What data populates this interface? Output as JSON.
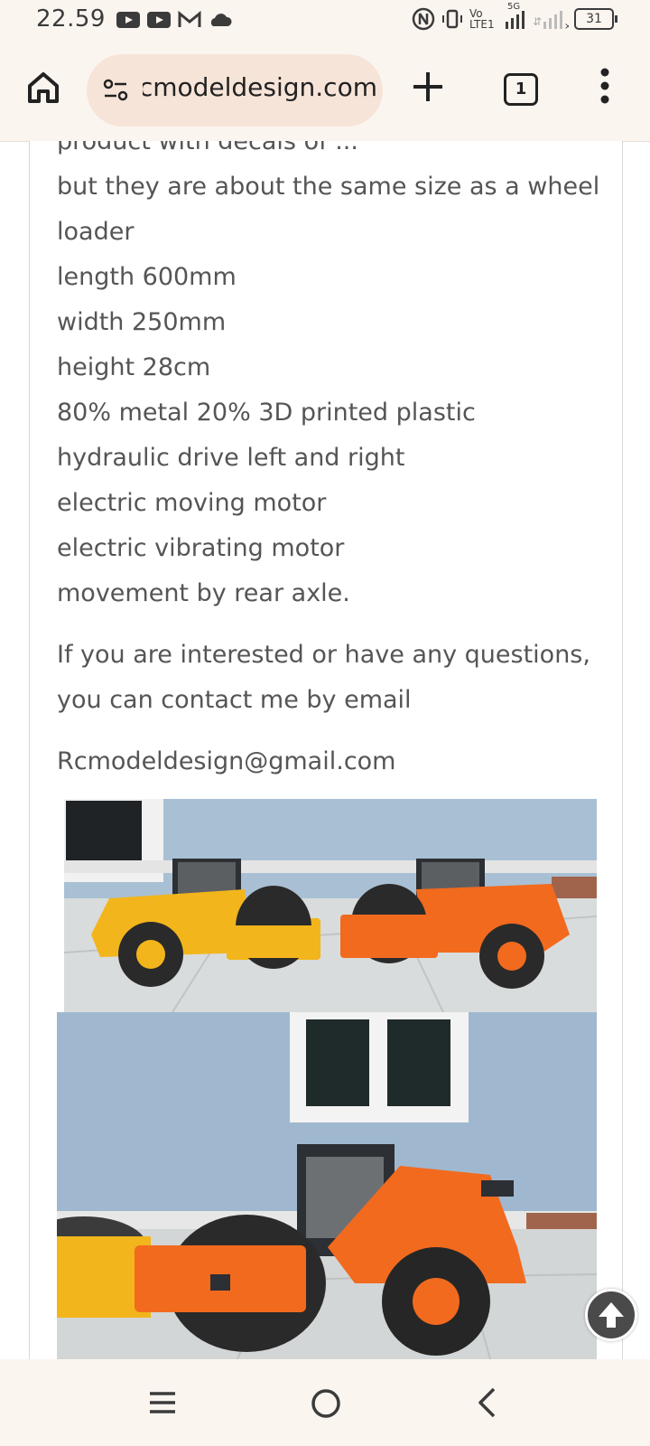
{
  "status_bar": {
    "time": "22.59",
    "network_vo": "Vo",
    "network_lte": "LTE1",
    "network_5g": "5G",
    "battery": "31"
  },
  "toolbar": {
    "url": "rcmodeldesign.com",
    "tab_count": "1"
  },
  "content": {
    "partial_line": "product with decals of ...",
    "lines": [
      "but they are about the same size as a wheel",
      "loader",
      "length 600mm",
      "width 250mm",
      "height 28cm",
      "80% metal 20% 3D printed plastic",
      "hydraulic drive left and right",
      "electric moving motor",
      "electric vibrating motor",
      "movement by rear axle."
    ],
    "contact_line1": "If you are interested or have any questions,",
    "contact_line2": "you can contact me by email",
    "email": "Rcmodeldesign@gmail.com"
  },
  "colors": {
    "chrome_bg": "#fbf5f0",
    "url_pill": "#f7e4d8",
    "body_text": "#555555",
    "roller_yellow": "#f2b51c",
    "roller_orange": "#f26a1e",
    "wall_blue": "#9fb8cf"
  },
  "icons": {
    "home": "home-icon",
    "site_settings": "site-settings-icon",
    "new_tab": "plus-icon",
    "menu": "more-vert-icon",
    "scroll_top": "arrow-up-icon"
  }
}
